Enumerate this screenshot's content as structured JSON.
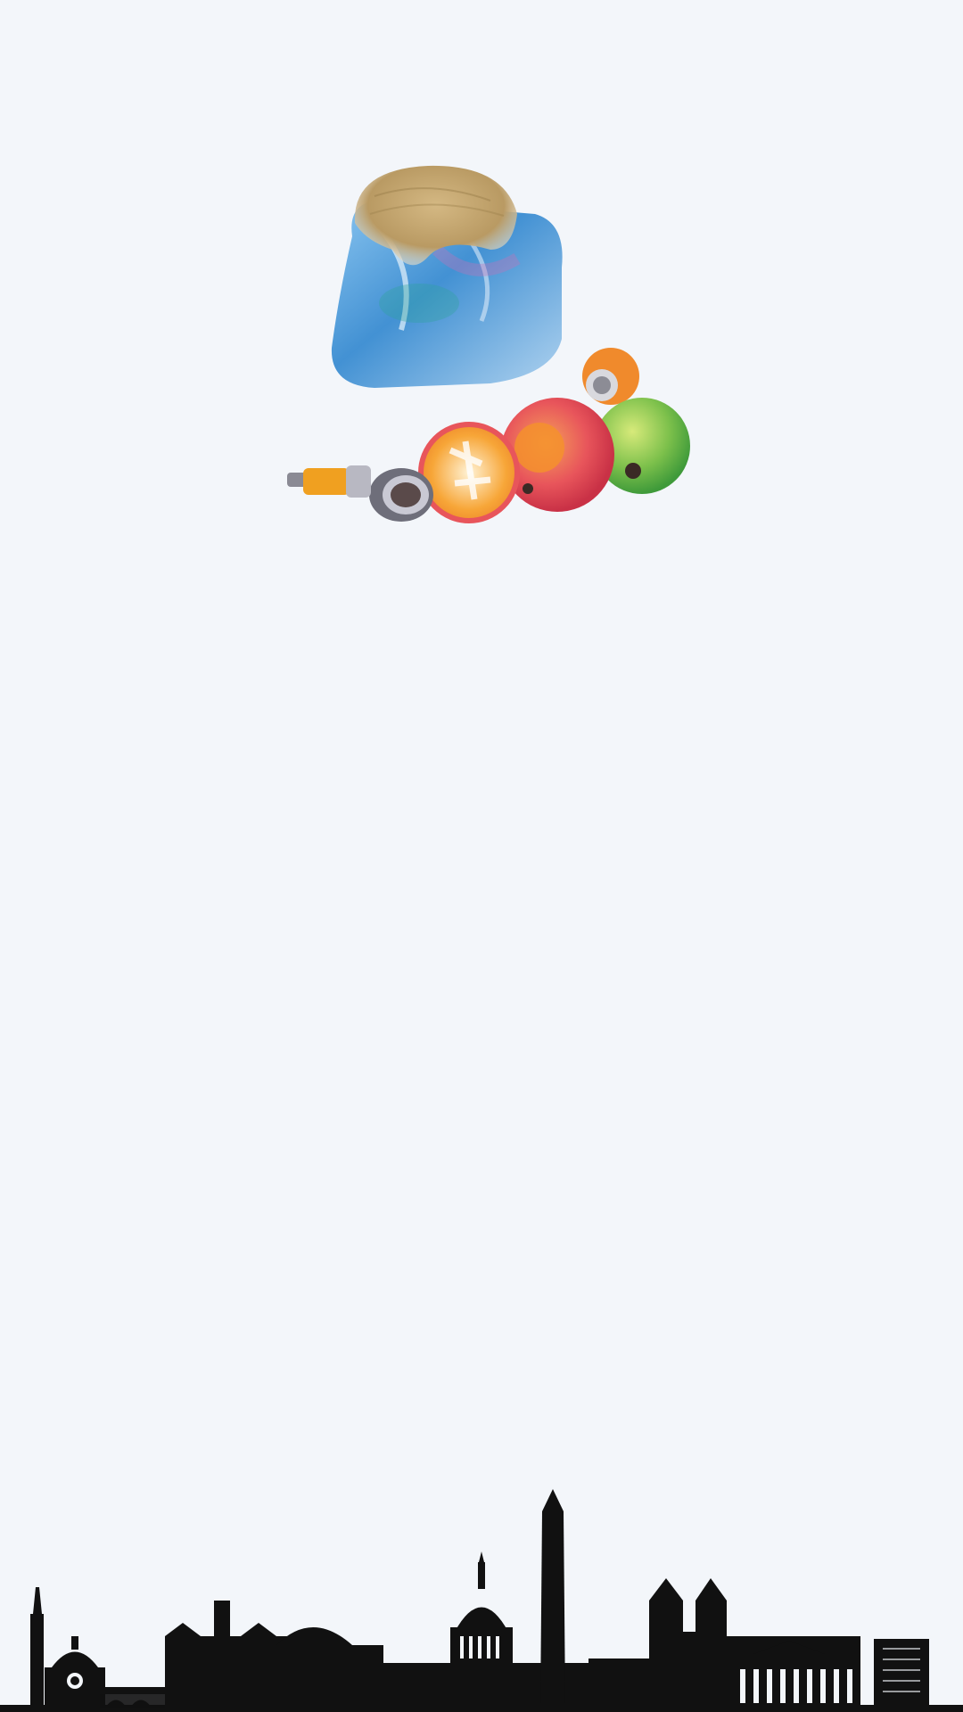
{
  "screen": {
    "background": "#f3f6fa"
  },
  "illustration": {
    "subject": "hair-on-trash-bag",
    "items": [
      "hair-tuft",
      "plastic-bag",
      "ball-orange",
      "ball-red",
      "ball-green",
      "fruit-slice",
      "bottle-cap",
      "spray-can"
    ],
    "colors": {
      "hair": "#b99a63",
      "bag": "#3b8fd1",
      "ball_red": "#e8555b",
      "ball_orange": "#f08a2c",
      "ball_green": "#7cc04b",
      "can": "#f0a020"
    }
  },
  "skyline": {
    "subject": "city-skyline-silhouette",
    "color": "#111111",
    "landmarks": [
      "clock-tower",
      "domed-church",
      "bridge",
      "capitol-dome",
      "obelisk-monument",
      "gothic-cathedral",
      "columned-building",
      "tower-block"
    ]
  }
}
